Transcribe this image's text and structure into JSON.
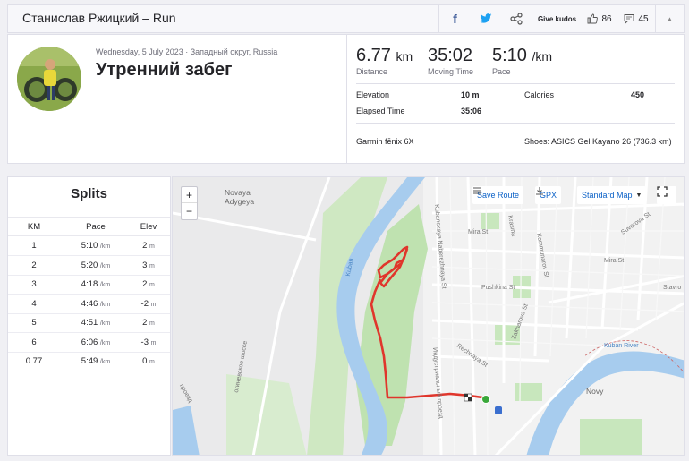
{
  "header": {
    "title": "Станислав Ржицкий – Run",
    "give_kudos": "Give kudos",
    "kudos_count": "86",
    "comments_count": "45"
  },
  "activity": {
    "date": "Wednesday, 5 July 2023 · Западный округ, Russia",
    "name": "Утренний забег"
  },
  "stats": {
    "distance_value": "6.77",
    "distance_unit": "km",
    "distance_label": "Distance",
    "moving_time_value": "35:02",
    "moving_time_label": "Moving Time",
    "pace_value": "5:10",
    "pace_unit": "/km",
    "pace_label": "Pace",
    "elevation_label": "Elevation",
    "elevation_value": "10 m",
    "calories_label": "Calories",
    "calories_value": "450",
    "elapsed_label": "Elapsed Time",
    "elapsed_value": "35:06",
    "device": "Garmin fēnix 6X",
    "shoes": "Shoes: ASICS Gel Kayano 26 (736.3 km)"
  },
  "splits": {
    "title": "Splits",
    "headers": [
      "KM",
      "Pace",
      "Elev"
    ],
    "rows": [
      {
        "km": "1",
        "pace": "5:10",
        "unit": "/km",
        "elev": "2",
        "elev_unit": "m"
      },
      {
        "km": "2",
        "pace": "5:20",
        "unit": "/km",
        "elev": "3",
        "elev_unit": "m"
      },
      {
        "km": "3",
        "pace": "4:18",
        "unit": "/km",
        "elev": "2",
        "elev_unit": "m"
      },
      {
        "km": "4",
        "pace": "4:46",
        "unit": "/km",
        "elev": "-2",
        "elev_unit": "m"
      },
      {
        "km": "5",
        "pace": "4:51",
        "unit": "/km",
        "elev": "2",
        "elev_unit": "m"
      },
      {
        "km": "6",
        "pace": "6:06",
        "unit": "/km",
        "elev": "-3",
        "elev_unit": "m"
      },
      {
        "km": "0.77",
        "pace": "5:49",
        "unit": "/km",
        "elev": "0",
        "elev_unit": "m"
      }
    ]
  },
  "map": {
    "zoom_in": "+",
    "zoom_out": "−",
    "save_route": "Save Route",
    "gpx": "GPX",
    "map_type": "Standard Map",
    "labels": {
      "novaya_adygeya": "Novaya\nAdygeya",
      "mira_st": "Mira St",
      "krasina": "Krasina",
      "kommunarov": "Kommunarov St",
      "suvorova": "Suvorova St",
      "mira_st2": "Mira St",
      "pushkina": "Pushkina St",
      "kuban_river": "Kuban River",
      "kuban": "Kuban",
      "novy": "Novy",
      "zakharova": "Zakharova St",
      "rechnaya": "Rechnaya St",
      "kubanskaya": "Kubanskaya Naberezhnaya St",
      "stavr": "Stavro",
      "industr": "Индустриальный проезд",
      "shosse": "огинeвское шоссе",
      "proezd": "проезд"
    }
  },
  "colors": {
    "route": "#e0362c",
    "water": "#a7ccee",
    "green": "#c8e7bd",
    "link": "#0b61c7",
    "brand_orange": "#fc5200"
  }
}
